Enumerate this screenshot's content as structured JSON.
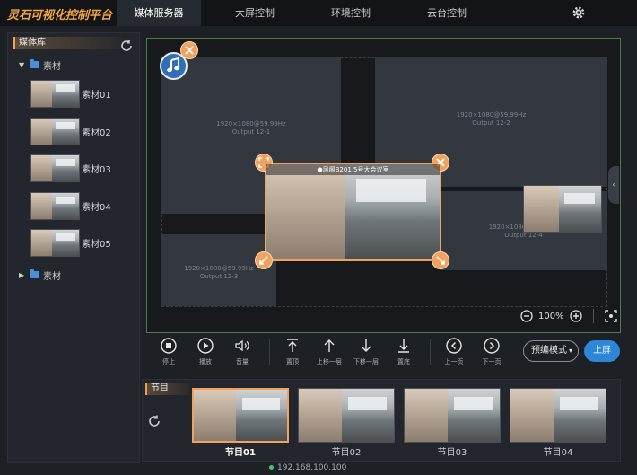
{
  "header": {
    "brand": "灵石可视化控制平台",
    "tabs": [
      {
        "label": "媒体服务器",
        "active": true
      },
      {
        "label": "大屏控制",
        "active": false
      },
      {
        "label": "环境控制",
        "active": false
      },
      {
        "label": "云台控制",
        "active": false
      }
    ],
    "settings_icon": "gear-icon"
  },
  "library": {
    "title": "媒体库",
    "folders": [
      {
        "label": "素材",
        "expanded": true,
        "items": [
          "素材01",
          "素材02",
          "素材03",
          "素材04",
          "素材05"
        ]
      },
      {
        "label": "素材",
        "expanded": false,
        "items": []
      }
    ]
  },
  "stage": {
    "outputs": [
      {
        "res": "1920×1080@59.99Hz",
        "name": "Output 12-1"
      },
      {
        "res": "1920×1080@59.99Hz",
        "name": "Output 12-2"
      },
      {
        "res": "1920×1080@59.99Hz",
        "name": "Output 12-3"
      },
      {
        "res": "1920×1080@59.99Hz",
        "name": "Output 12-4"
      }
    ],
    "window_title": "●风阁B201 5号大会议室",
    "zoom": "100%"
  },
  "toolbar": {
    "buttons": [
      "停止",
      "播放",
      "音量",
      "置顶",
      "上移一层",
      "下移一层",
      "置底",
      "上一页",
      "下一页"
    ],
    "mode": "预编模式",
    "apply": "上屏"
  },
  "program": {
    "title": "节目",
    "items": [
      "节目01",
      "节目02",
      "节目03",
      "节目04"
    ],
    "selected": 0
  },
  "status": {
    "ip": "192.168.100.100"
  },
  "colors": {
    "accent": "#f0a260",
    "primary": "#2d87d8",
    "online": "#49c26a"
  }
}
